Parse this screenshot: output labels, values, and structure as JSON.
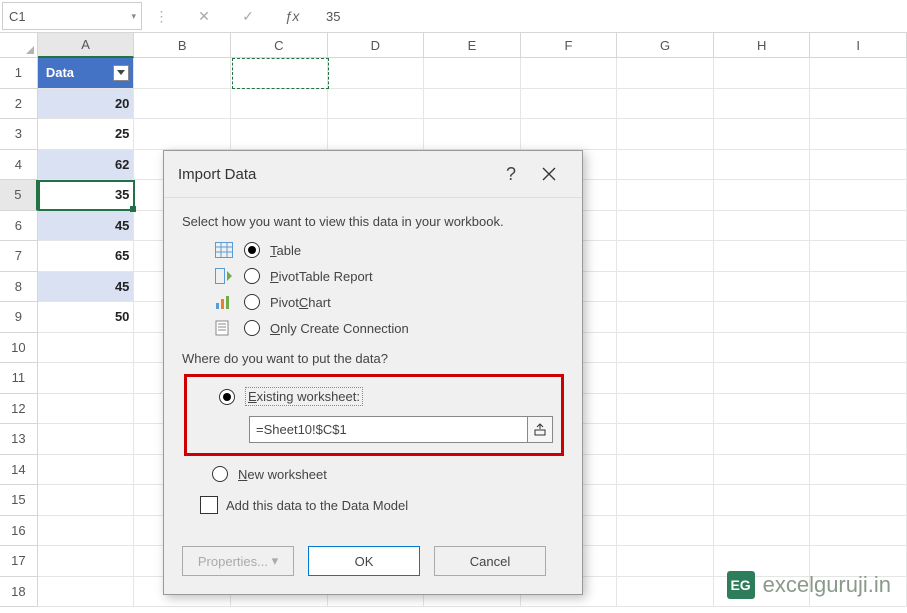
{
  "name_box": "C1",
  "formula_value": "35",
  "columns": [
    "A",
    "B",
    "C",
    "D",
    "E",
    "F",
    "G",
    "H",
    "I"
  ],
  "rows_count": 18,
  "table": {
    "header": "Data",
    "values": [
      20,
      25,
      62,
      35,
      45,
      65,
      45,
      50
    ]
  },
  "active_cell": {
    "col": "A",
    "row": 5
  },
  "marquee_cell": {
    "col": "C",
    "row": 1
  },
  "dialog": {
    "title": "Import Data",
    "help": "?",
    "prompt1": "Select how you want to view this data in your workbook.",
    "options_view": [
      {
        "label_pre": "",
        "u": "T",
        "label_post": "able",
        "checked": true
      },
      {
        "label_pre": "",
        "u": "P",
        "label_post": "ivotTable Report",
        "checked": false
      },
      {
        "label_pre": "Pivot",
        "u": "C",
        "label_post": "hart",
        "checked": false
      },
      {
        "label_pre": "",
        "u": "O",
        "label_post": "nly Create Connection",
        "checked": false
      }
    ],
    "prompt2": "Where do you want to put the data?",
    "loc_existing": {
      "checked": true,
      "u": "E",
      "label": "xisting worksheet:"
    },
    "ref_value": "=Sheet10!$C$1",
    "loc_new": {
      "checked": false,
      "u": "N",
      "label": "ew worksheet"
    },
    "checkbox_label_pre": "Add this data to the Data ",
    "checkbox_u": "M",
    "checkbox_label_post": "odel",
    "btn_properties": "Properties...",
    "btn_ok": "OK",
    "btn_cancel": "Cancel"
  },
  "watermark": "excelguruji.in"
}
